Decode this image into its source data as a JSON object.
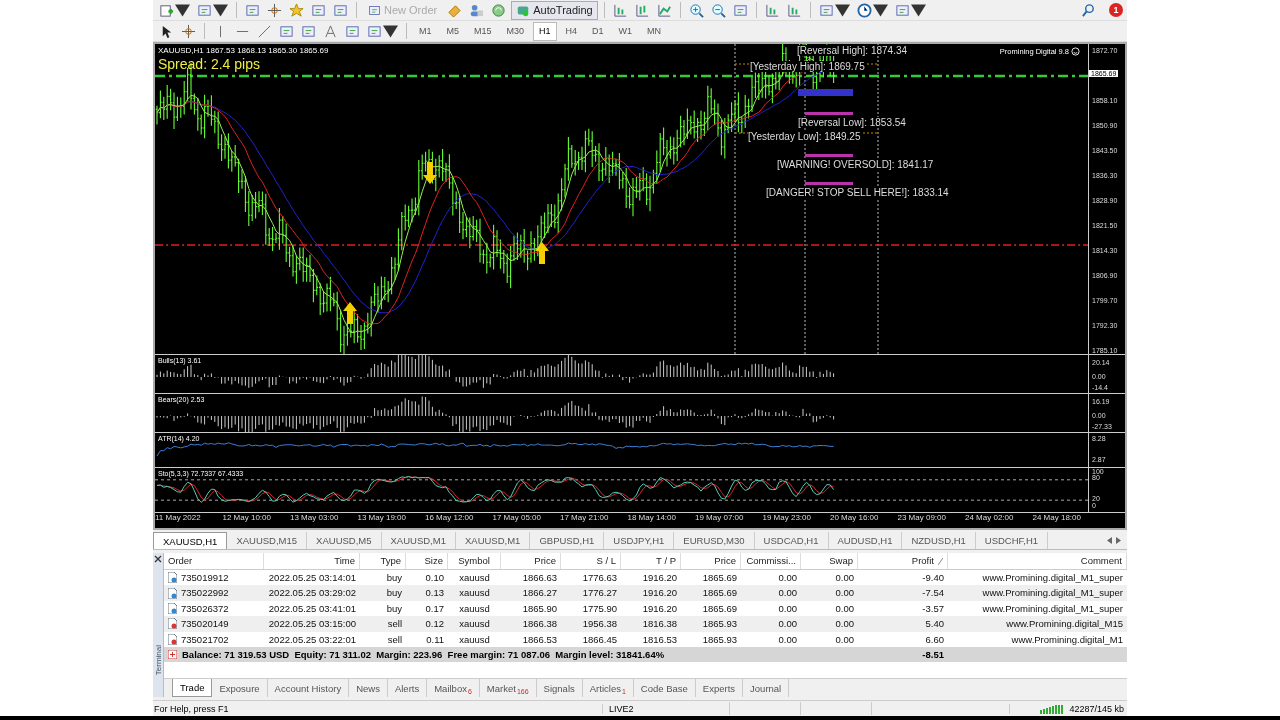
{
  "toolbar": {
    "new_order": {
      "label": "New Order",
      "disabled": true
    },
    "auto_trading": {
      "label": "AutoTrading",
      "on": true
    },
    "notifications": "1"
  },
  "timeframes": [
    {
      "label": "M1",
      "selected": false
    },
    {
      "label": "M5",
      "selected": false
    },
    {
      "label": "M15",
      "selected": false
    },
    {
      "label": "M30",
      "selected": false
    },
    {
      "label": "H1",
      "selected": true
    },
    {
      "label": "H4",
      "selected": false
    },
    {
      "label": "D1",
      "selected": false
    },
    {
      "label": "W1",
      "selected": false
    },
    {
      "label": "MN",
      "selected": false
    }
  ],
  "chart": {
    "header": "XAUUSD,H1  1867.53 1868.13 1865.30 1865.69",
    "spread": "Spread: 2.4 pips",
    "expert": "Promining Digital 9.8",
    "current_price": "1865.69",
    "price_ticks": [
      "1872.70",
      "1858.10",
      "1850.90",
      "1843.50",
      "1836.30",
      "1828.90",
      "1821.50",
      "1814.30",
      "1806.90",
      "1799.70",
      "1792.30",
      "1785.10"
    ],
    "levels": [
      "[Reversal High]: 1874.34",
      "[Yesterday High]: 1869.75",
      "[Reversal Low]: 1853.54",
      "[Yesterday Low]: 1849.25",
      "[WARNING! OVERSOLD]: 1841.17",
      "[DANGER! STOP SELL HERE!]: 1833.14"
    ]
  },
  "indicators": [
    {
      "kind": "bulls",
      "title": "Bulls(13) 3.61",
      "ticks": [
        "20.14",
        "0.00",
        "-14.4"
      ]
    },
    {
      "kind": "bears",
      "title": "Bears(20) 2.53",
      "ticks": [
        "16.19",
        "0.00",
        "-27.33"
      ]
    },
    {
      "kind": "atr",
      "title": "ATR(14) 4.20",
      "ticks": [
        "8.28",
        "2.87"
      ]
    },
    {
      "kind": "stochastic",
      "title": "Sto(5,3,3) 72.7337 67.4333",
      "ticks": [
        "100",
        "80",
        "20",
        "0"
      ]
    }
  ],
  "time_axis": [
    "11 May 2022",
    "12 May 10:00",
    "13 May 03:00",
    "13 May 19:00",
    "16 May 12:00",
    "17 May 05:00",
    "17 May 21:00",
    "18 May 14:00",
    "19 May 07:00",
    "19 May 23:00",
    "20 May 16:00",
    "23 May 09:00",
    "24 May 02:00",
    "24 May 18:00"
  ],
  "chart_tabs": [
    {
      "label": "XAUUSD,H1",
      "selected": true
    },
    {
      "label": "XAUUSD,M15",
      "selected": false
    },
    {
      "label": "XAUUSD,M5",
      "selected": false
    },
    {
      "label": "XAUUSD,M1",
      "selected": false
    },
    {
      "label": "XAUUSD,M1",
      "selected": false
    },
    {
      "label": "GBPUSD,H1",
      "selected": false
    },
    {
      "label": "USDJPY,H1",
      "selected": false
    },
    {
      "label": "EURUSD,M30",
      "selected": false
    },
    {
      "label": "USDCAD,H1",
      "selected": false
    },
    {
      "label": "AUDUSD,H1",
      "selected": false
    },
    {
      "label": "NZDUSD,H1",
      "selected": false
    },
    {
      "label": "USDCHF,H1",
      "selected": false
    }
  ],
  "orders": {
    "columns": [
      "Order",
      "Time",
      "Type",
      "Size",
      "Symbol",
      "Price",
      "S / L",
      "T / P",
      "Price",
      "Commissi...",
      "Swap",
      "Profit",
      "Comment"
    ],
    "rows": [
      {
        "kind": "buy",
        "cells": [
          "735019912",
          "2022.05.25 03:14:01",
          "buy",
          "0.10",
          "xauusd",
          "1866.63",
          "1776.63",
          "1916.20",
          "1865.69",
          "0.00",
          "0.00",
          "-9.40",
          "www.Promining.digital_M1_super"
        ]
      },
      {
        "kind": "buy",
        "cells": [
          "735022992",
          "2022.05.25 03:29:02",
          "buy",
          "0.13",
          "xauusd",
          "1866.27",
          "1776.27",
          "1916.20",
          "1865.69",
          "0.00",
          "0.00",
          "-7.54",
          "www.Promining.digital_M1_super"
        ]
      },
      {
        "kind": "buy",
        "cells": [
          "735026372",
          "2022.05.25 03:41:01",
          "buy",
          "0.17",
          "xauusd",
          "1865.90",
          "1775.90",
          "1916.20",
          "1865.69",
          "0.00",
          "0.00",
          "-3.57",
          "www.Promining.digital_M1_super"
        ]
      },
      {
        "kind": "sell",
        "cells": [
          "735020149",
          "2022.05.25 03:15:00",
          "sell",
          "0.12",
          "xauusd",
          "1866.38",
          "1956.38",
          "1816.38",
          "1865.93",
          "0.00",
          "0.00",
          "5.40",
          "www.Promining.digital_M15"
        ]
      },
      {
        "kind": "sell",
        "cells": [
          "735021702",
          "2022.05.25 03:22:01",
          "sell",
          "0.11",
          "xauusd",
          "1866.53",
          "1866.45",
          "1816.53",
          "1865.93",
          "0.00",
          "0.00",
          "6.60",
          "www.Promining.digital_M1"
        ]
      }
    ],
    "balance": "Balance: 71 319.53 USD  Equity: 71 311.02  Margin: 223.96  Free margin: 71 087.06  Margin level: 31841.64%",
    "total_profit": "-8.51"
  },
  "terminal_label": "Terminal",
  "terminal_tabs": [
    {
      "label": "Trade",
      "selected": true
    },
    {
      "label": "Exposure",
      "selected": false
    },
    {
      "label": "Account History",
      "selected": false
    },
    {
      "label": "News",
      "selected": false
    },
    {
      "label": "Alerts",
      "selected": false
    },
    {
      "label": "Mailbox",
      "selected": false,
      "badge": "6"
    },
    {
      "label": "Market",
      "selected": false,
      "badge": "166"
    },
    {
      "label": "Signals",
      "selected": false
    },
    {
      "label": "Articles",
      "selected": false,
      "badge": "1"
    },
    {
      "label": "Code Base",
      "selected": false
    },
    {
      "label": "Experts",
      "selected": false
    },
    {
      "label": "Journal",
      "selected": false
    }
  ],
  "status_bar": {
    "help": "For Help, press F1",
    "server": "LIVE2",
    "traffic": "42287/145 kb"
  }
}
